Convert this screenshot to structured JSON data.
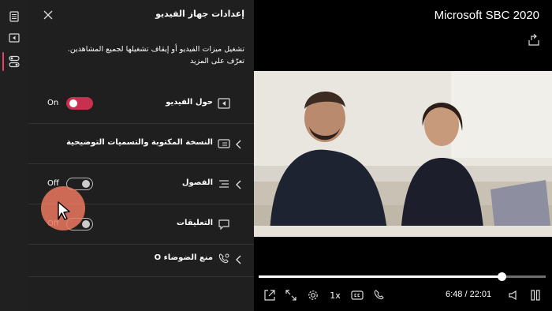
{
  "app": {
    "title": "Microsoft SBC 2020"
  },
  "panel": {
    "title": "إعدادات جهاز الفيديو",
    "description": "تشغيل ميزات الفيديو أو إيقاف تشغيلها لجميع المشاهدين.",
    "learn_more": "تعرّف على المزيد",
    "rows": [
      {
        "label": "حول الفيديو",
        "toggle_text": "On",
        "toggle_on": true
      },
      {
        "label": "النسخة المكتوبة والتسميات التوضيحية"
      },
      {
        "label": "الفصول",
        "toggle_text": "Off",
        "toggle_on": false
      },
      {
        "label": "التعليقات",
        "toggle_text": "Off",
        "toggle_on": false
      },
      {
        "label": "منع الضوضاء O"
      }
    ]
  },
  "player": {
    "time": "6:48 / 22:01",
    "speed": "1x",
    "progress_fraction": 0.845
  },
  "colors": {
    "accent": "#c8304f",
    "panel_bg": "#1f1f1f",
    "rail_bg": "#202020"
  }
}
